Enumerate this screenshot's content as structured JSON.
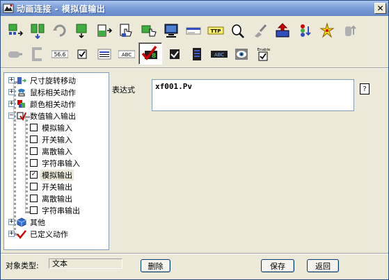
{
  "window": {
    "title": "动画连接 - 模拟值输出",
    "close_glyph": "✕"
  },
  "toolbar": {
    "row1": [
      "move-icon",
      "move-arrows-icon",
      "rotate-icon",
      "resize-icon",
      "fill-icon",
      "hand-icon",
      "mouse-action-icon",
      "monitor-icon",
      "slider-icon",
      "tooltip-icon",
      "magnifier-icon",
      "brush-icon",
      "upload-icon",
      "traffic-light-icon",
      "flash-icon",
      "cylinder-icon"
    ],
    "row2": [
      "pipe-icon",
      "bracket-icon",
      "numeric-input-icon",
      "checkbox-icon",
      "list-icon",
      "text-input-icon",
      "analog-output-icon",
      "checkbox-dark-icon",
      "lcd-icon",
      "text-output-icon",
      "visibility-icon",
      "enable-icon"
    ],
    "labels": {
      "numeric": "56.6",
      "text_in": "ABC",
      "text_out": "ABC",
      "tooltip": "TTP",
      "enable": "Enable",
      "analog_digit": "8"
    }
  },
  "tree": {
    "items": [
      {
        "label": "尺寸旋转移动",
        "pm": "+",
        "checked": ""
      },
      {
        "label": "鼠标相关动作",
        "pm": "+",
        "checked": ""
      },
      {
        "label": "颜色相关动作",
        "pm": "+",
        "checked": ""
      },
      {
        "label": "数值输入输出",
        "pm": "−",
        "checked": ""
      },
      {
        "label": "模拟输入",
        "pm": "",
        "checked": ""
      },
      {
        "label": "开关输入",
        "pm": "",
        "checked": ""
      },
      {
        "label": "离散输入",
        "pm": "",
        "checked": ""
      },
      {
        "label": "字符串输入",
        "pm": "",
        "checked": ""
      },
      {
        "label": "模拟输出",
        "pm": "",
        "checked": "✓"
      },
      {
        "label": "开关输出",
        "pm": "",
        "checked": ""
      },
      {
        "label": "离散输出",
        "pm": "",
        "checked": ""
      },
      {
        "label": "字符串输出",
        "pm": "",
        "checked": ""
      },
      {
        "label": "其他",
        "pm": "+",
        "checked": ""
      },
      {
        "label": "已定义动作",
        "pm": "+",
        "checked": ""
      }
    ]
  },
  "expression": {
    "label": "表达式",
    "value": "xf001.Pv",
    "help_label": "?"
  },
  "footer": {
    "object_type_label": "对象类型:",
    "object_type_value": "文本",
    "delete_label": "删除",
    "save_label": "保存",
    "back_label": "返回"
  },
  "colors": {
    "titlebar": "#7C9FD8",
    "dialog_bg": "#ECE9D8",
    "tree_border": "#7F9DB9"
  }
}
